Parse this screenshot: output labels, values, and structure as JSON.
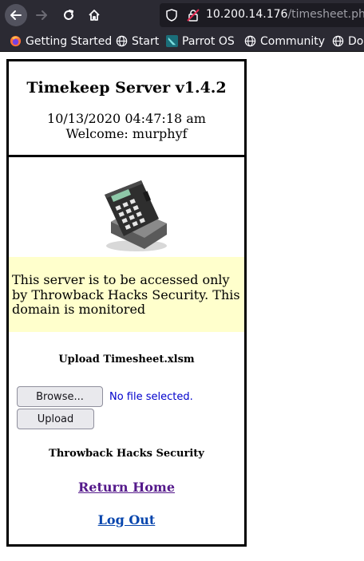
{
  "browser": {
    "url_host": "10.200.14.176",
    "url_path": "/timesheet.php",
    "bookmarks": [
      {
        "label": "Getting Started",
        "icon": "firefox-icon"
      },
      {
        "label": "Start",
        "icon": "globe-icon"
      },
      {
        "label": "Parrot OS",
        "icon": "parrot-icon"
      },
      {
        "label": "Community",
        "icon": "globe-icon"
      },
      {
        "label": "Doc",
        "icon": "globe-icon"
      }
    ]
  },
  "header": {
    "title": "Timekeep Server v1.4.2",
    "datetime": "10/13/2020 04:47:18 am",
    "welcome": "Welcome: murphyf"
  },
  "notice": {
    "text": "This server is to be accessed only by Throwback Hacks Security. This domain is monitored"
  },
  "upload": {
    "heading": "Upload Timesheet.xlsm",
    "browse_label": "Browse...",
    "no_file_text": "No file selected.",
    "upload_label": "Upload"
  },
  "footer": {
    "company": "Throwback Hacks Security",
    "return_home": "Return Home",
    "logout": "Log Out"
  },
  "colors": {
    "chrome_bg": "#2b2a33",
    "notice_bg": "#ffffcc",
    "visited_link": "#551a8b",
    "link": "#0645ad"
  }
}
